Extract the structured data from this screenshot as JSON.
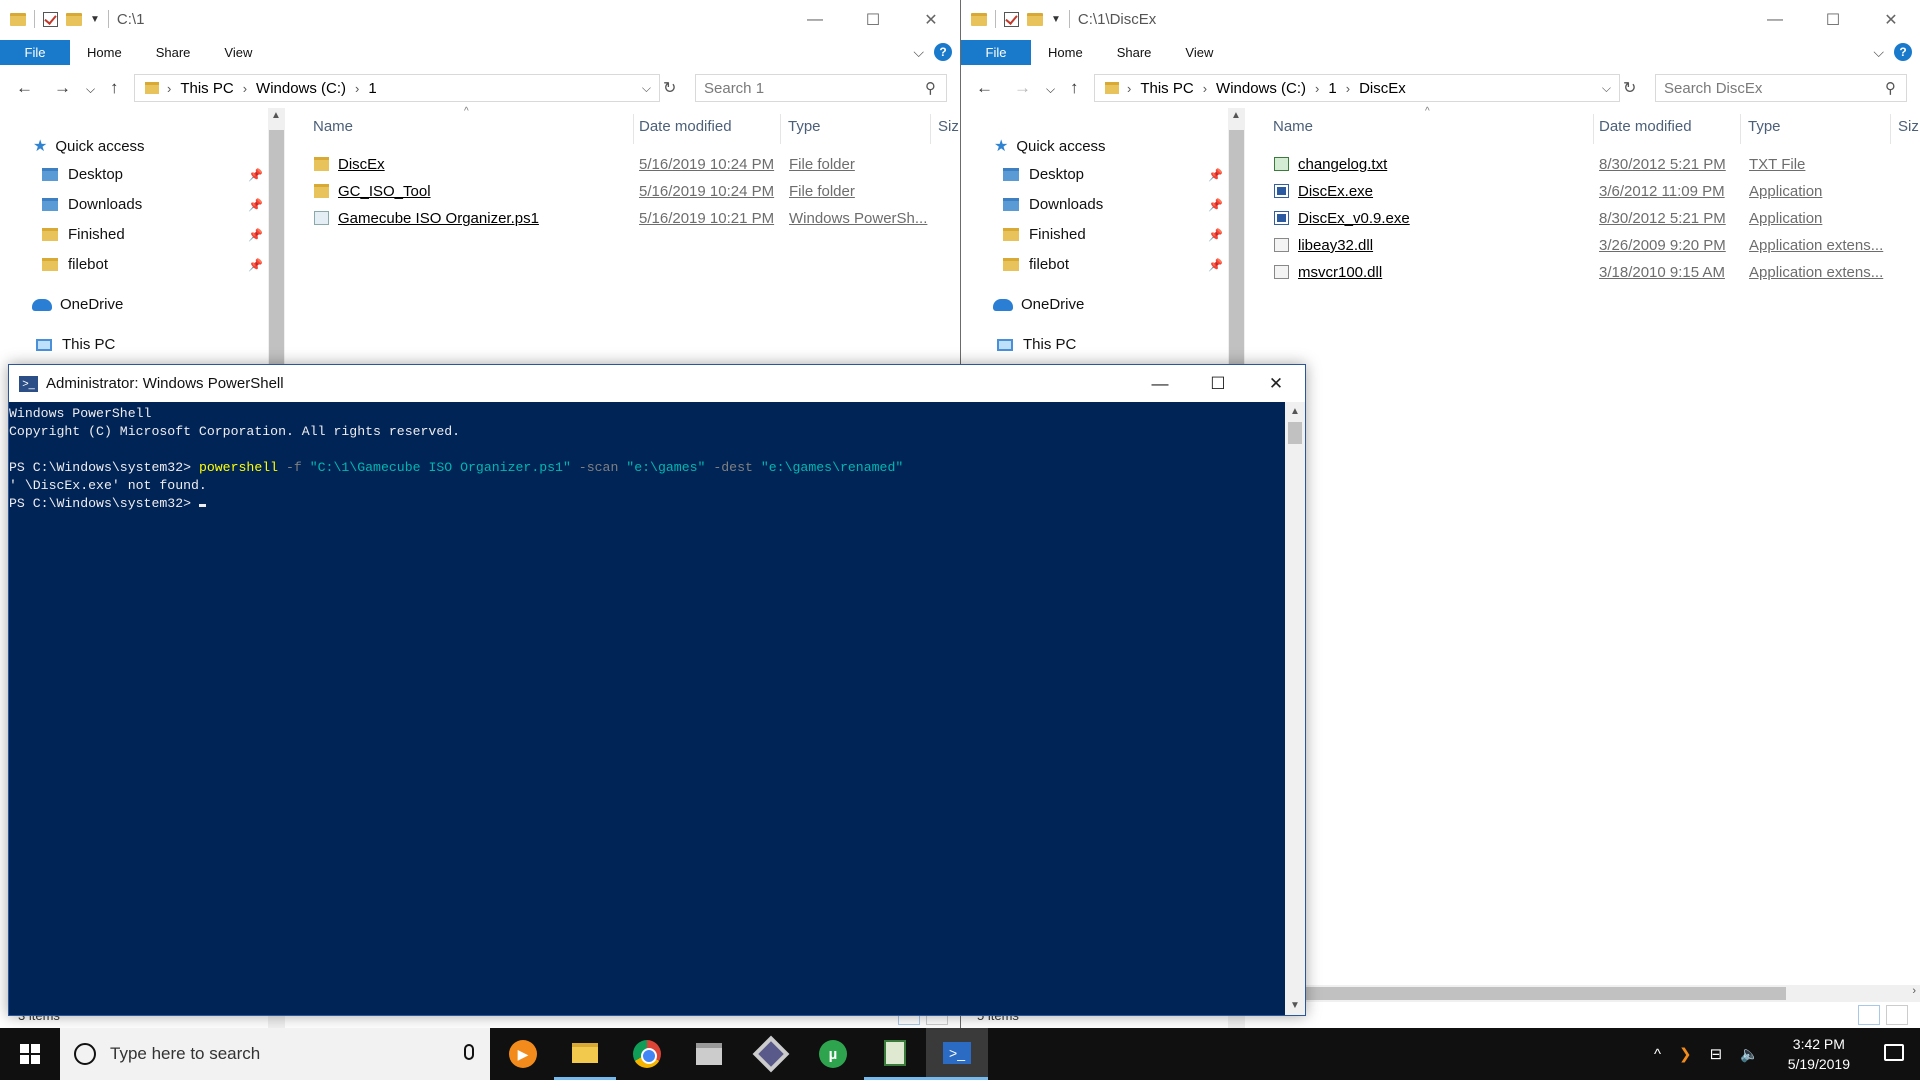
{
  "left_explorer": {
    "title_path": "C:\\1",
    "tabs": [
      "File",
      "Home",
      "Share",
      "View"
    ],
    "breadcrumb": [
      "This PC",
      "Windows (C:)",
      "1"
    ],
    "search_placeholder": "Search 1",
    "columns": [
      "Name",
      "Date modified",
      "Type",
      "Siz"
    ],
    "files": [
      {
        "name": "DiscEx",
        "date": "5/16/2019 10:24 PM",
        "type": "File folder",
        "icon": "folder-icon"
      },
      {
        "name": "GC_ISO_Tool",
        "date": "5/16/2019 10:24 PM",
        "type": "File folder",
        "icon": "folder-icon"
      },
      {
        "name": "Gamecube ISO Organizer.ps1",
        "date": "5/16/2019 10:21 PM",
        "type": "Windows PowerSh...",
        "icon": "powershell-script-icon"
      }
    ],
    "status": "3 items"
  },
  "right_explorer": {
    "title_path": "C:\\1\\DiscEx",
    "tabs": [
      "File",
      "Home",
      "Share",
      "View"
    ],
    "breadcrumb": [
      "This PC",
      "Windows (C:)",
      "1",
      "DiscEx"
    ],
    "search_placeholder": "Search DiscEx",
    "columns": [
      "Name",
      "Date modified",
      "Type",
      "Siz"
    ],
    "files": [
      {
        "name": "changelog.txt",
        "date": "8/30/2012 5:21 PM",
        "type": "TXT File",
        "icon": "text-file-icon"
      },
      {
        "name": "DiscEx.exe",
        "date": "3/6/2012 11:09 PM",
        "type": "Application",
        "icon": "application-icon"
      },
      {
        "name": "DiscEx_v0.9.exe",
        "date": "8/30/2012 5:21 PM",
        "type": "Application",
        "icon": "application-icon"
      },
      {
        "name": "libeay32.dll",
        "date": "3/26/2009 9:20 PM",
        "type": "Application extens...",
        "icon": "dll-icon"
      },
      {
        "name": "msvcr100.dll",
        "date": "3/18/2010 9:15 AM",
        "type": "Application extens...",
        "icon": "dll-icon"
      }
    ],
    "status": "5 items"
  },
  "nav_pane": {
    "quick_access": "Quick access",
    "items": [
      "Desktop",
      "Downloads",
      "Finished",
      "filebot"
    ],
    "onedrive": "OneDrive",
    "this_pc": "This PC"
  },
  "powershell": {
    "title": "Administrator: Windows PowerShell",
    "lines": {
      "banner1": "Windows PowerShell",
      "banner2": "Copyright (C) Microsoft Corporation. All rights reserved.",
      "prompt1": "PS C:\\Windows\\system32> ",
      "cmd": "powershell",
      "p_f": " -f ",
      "s_file": "\"C:\\1\\Gamecube ISO Organizer.ps1\"",
      "p_scan": " -scan ",
      "s_scan": "\"e:\\games\"",
      "p_dest": " -dest ",
      "s_dest": "\"e:\\games\\renamed\"",
      "error": "' \\DiscEx.exe' not found.",
      "prompt2": "PS C:\\Windows\\system32> "
    }
  },
  "taskbar": {
    "search_placeholder": "Type here to search",
    "apps": [
      "vlc-icon",
      "file-explorer-icon",
      "chrome-icon",
      "store-icon",
      "gamecube-icon",
      "utorrent-icon",
      "notepad-icon",
      "powershell-icon"
    ],
    "time": "3:42 PM",
    "date": "5/19/2019"
  },
  "colors": {
    "accent": "#1979ca",
    "console_bg": "#012456",
    "cmd": "#ffff00",
    "string": "#00b7b0",
    "param": "#808080"
  }
}
